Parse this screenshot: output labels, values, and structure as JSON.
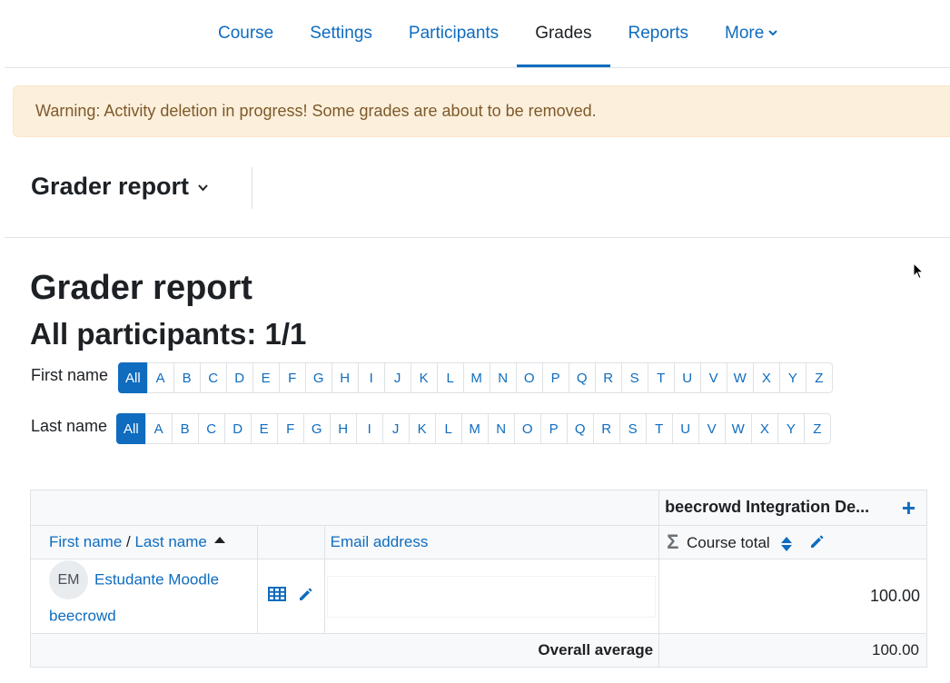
{
  "nav": {
    "tabs": [
      {
        "label": "Course",
        "active": false
      },
      {
        "label": "Settings",
        "active": false
      },
      {
        "label": "Participants",
        "active": false
      },
      {
        "label": "Grades",
        "active": true
      },
      {
        "label": "Reports",
        "active": false
      },
      {
        "label": "More",
        "active": false
      }
    ]
  },
  "warning": "Warning: Activity deletion in progress! Some grades are about to be removed.",
  "report_selector": "Grader report",
  "page_title": "Grader report",
  "participants_heading": "All participants: 1/1",
  "initials": {
    "first_label": "First name",
    "last_label": "Last name",
    "all_label": "All",
    "letters": [
      "A",
      "B",
      "C",
      "D",
      "E",
      "F",
      "G",
      "H",
      "I",
      "J",
      "K",
      "L",
      "M",
      "N",
      "O",
      "P",
      "Q",
      "R",
      "S",
      "T",
      "U",
      "V",
      "W",
      "X",
      "Y",
      "Z"
    ]
  },
  "table": {
    "category": "beecrowd Integration De...",
    "col_first": "First name",
    "col_sep": " / ",
    "col_last": "Last name",
    "col_email": "Email address",
    "col_total": "Course total",
    "user": {
      "initials": "EM",
      "name": "Estudante Moodle",
      "last": "beecrowd",
      "email": "",
      "grade": "100.00"
    },
    "avg_label": "Overall average",
    "avg_value": "100.00"
  },
  "colors": {
    "link": "#0f6cbf",
    "warning_bg": "#fcefdc",
    "warning_text": "#7d5a29"
  }
}
